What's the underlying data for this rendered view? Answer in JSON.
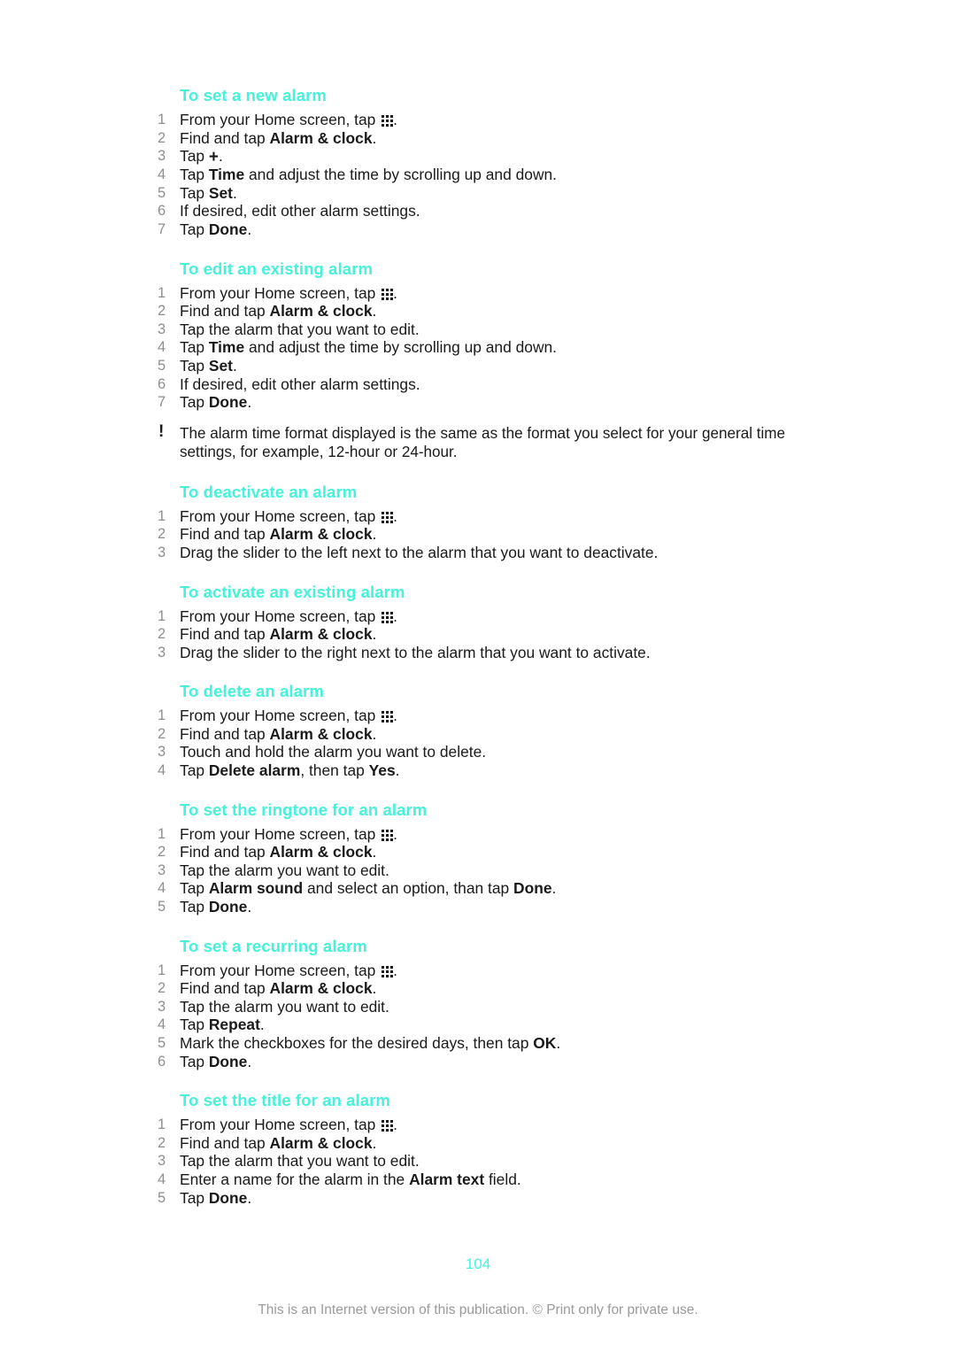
{
  "document": {
    "page_number": "104",
    "footer_note": "This is an Internet version of this publication. © Print only for private use.",
    "heading_color": "#45f2da",
    "number_color": "#8e8e8e",
    "body_color": "#1a1a1a",
    "footer_color": "#9a9a9a"
  },
  "icons": {
    "app_drawer": "app-drawer-icon",
    "plus": "+",
    "note_marker": "!"
  },
  "sections": [
    {
      "heading": "To set a new alarm",
      "steps": [
        {
          "num": "1",
          "parts": [
            {
              "t": "From your Home screen, tap "
            },
            {
              "icon": "app-drawer"
            },
            {
              "t": "."
            }
          ]
        },
        {
          "num": "2",
          "parts": [
            {
              "t": "Find and tap "
            },
            {
              "t": "Alarm & clock",
              "b": true
            },
            {
              "t": "."
            }
          ]
        },
        {
          "num": "3",
          "parts": [
            {
              "t": "Tap "
            },
            {
              "icon": "plus"
            },
            {
              "t": "."
            }
          ]
        },
        {
          "num": "4",
          "parts": [
            {
              "t": "Tap "
            },
            {
              "t": "Time",
              "b": true
            },
            {
              "t": " and adjust the time by scrolling up and down."
            }
          ]
        },
        {
          "num": "5",
          "parts": [
            {
              "t": "Tap "
            },
            {
              "t": "Set",
              "b": true
            },
            {
              "t": "."
            }
          ]
        },
        {
          "num": "6",
          "parts": [
            {
              "t": "If desired, edit other alarm settings."
            }
          ]
        },
        {
          "num": "7",
          "parts": [
            {
              "t": "Tap "
            },
            {
              "t": "Done",
              "b": true
            },
            {
              "t": "."
            }
          ]
        }
      ]
    },
    {
      "heading": "To edit an existing alarm",
      "steps": [
        {
          "num": "1",
          "parts": [
            {
              "t": "From your Home screen, tap "
            },
            {
              "icon": "app-drawer"
            },
            {
              "t": "."
            }
          ]
        },
        {
          "num": "2",
          "parts": [
            {
              "t": "Find and tap "
            },
            {
              "t": "Alarm & clock",
              "b": true
            },
            {
              "t": "."
            }
          ]
        },
        {
          "num": "3",
          "parts": [
            {
              "t": "Tap the alarm that you want to edit."
            }
          ]
        },
        {
          "num": "4",
          "parts": [
            {
              "t": "Tap "
            },
            {
              "t": "Time",
              "b": true
            },
            {
              "t": " and adjust the time by scrolling up and down."
            }
          ]
        },
        {
          "num": "5",
          "parts": [
            {
              "t": "Tap "
            },
            {
              "t": "Set",
              "b": true
            },
            {
              "t": "."
            }
          ]
        },
        {
          "num": "6",
          "parts": [
            {
              "t": "If desired, edit other alarm settings."
            }
          ]
        },
        {
          "num": "7",
          "parts": [
            {
              "t": "Tap "
            },
            {
              "t": "Done",
              "b": true
            },
            {
              "t": "."
            }
          ]
        }
      ],
      "note": "The alarm time format displayed is the same as the format you select for your general time settings, for example, 12-hour or 24-hour."
    },
    {
      "heading": "To deactivate an alarm",
      "steps": [
        {
          "num": "1",
          "parts": [
            {
              "t": "From your Home screen, tap "
            },
            {
              "icon": "app-drawer"
            },
            {
              "t": "."
            }
          ]
        },
        {
          "num": "2",
          "parts": [
            {
              "t": "Find and tap "
            },
            {
              "t": "Alarm & clock",
              "b": true
            },
            {
              "t": "."
            }
          ]
        },
        {
          "num": "3",
          "parts": [
            {
              "t": "Drag the slider to the left next to the alarm that you want to deactivate."
            }
          ]
        }
      ]
    },
    {
      "heading": "To activate an existing alarm",
      "steps": [
        {
          "num": "1",
          "parts": [
            {
              "t": "From your Home screen, tap "
            },
            {
              "icon": "app-drawer"
            },
            {
              "t": "."
            }
          ]
        },
        {
          "num": "2",
          "parts": [
            {
              "t": "Find and tap "
            },
            {
              "t": "Alarm & clock",
              "b": true
            },
            {
              "t": "."
            }
          ]
        },
        {
          "num": "3",
          "parts": [
            {
              "t": "Drag the slider to the right next to the alarm that you want to activate."
            }
          ]
        }
      ]
    },
    {
      "heading": "To delete an alarm",
      "steps": [
        {
          "num": "1",
          "parts": [
            {
              "t": "From your Home screen, tap "
            },
            {
              "icon": "app-drawer"
            },
            {
              "t": "."
            }
          ]
        },
        {
          "num": "2",
          "parts": [
            {
              "t": "Find and tap "
            },
            {
              "t": "Alarm & clock",
              "b": true
            },
            {
              "t": "."
            }
          ]
        },
        {
          "num": "3",
          "parts": [
            {
              "t": "Touch and hold the alarm you want to delete."
            }
          ]
        },
        {
          "num": "4",
          "parts": [
            {
              "t": "Tap "
            },
            {
              "t": "Delete alarm",
              "b": true
            },
            {
              "t": ", then tap "
            },
            {
              "t": "Yes",
              "b": true
            },
            {
              "t": "."
            }
          ]
        }
      ]
    },
    {
      "heading": "To set the ringtone for an alarm",
      "steps": [
        {
          "num": "1",
          "parts": [
            {
              "t": "From your Home screen, tap "
            },
            {
              "icon": "app-drawer"
            },
            {
              "t": "."
            }
          ]
        },
        {
          "num": "2",
          "parts": [
            {
              "t": "Find and tap "
            },
            {
              "t": "Alarm & clock",
              "b": true
            },
            {
              "t": "."
            }
          ]
        },
        {
          "num": "3",
          "parts": [
            {
              "t": "Tap the alarm you want to edit."
            }
          ]
        },
        {
          "num": "4",
          "parts": [
            {
              "t": "Tap "
            },
            {
              "t": "Alarm sound",
              "b": true
            },
            {
              "t": " and select an option, than tap "
            },
            {
              "t": "Done",
              "b": true
            },
            {
              "t": "."
            }
          ]
        },
        {
          "num": "5",
          "parts": [
            {
              "t": "Tap "
            },
            {
              "t": "Done",
              "b": true
            },
            {
              "t": "."
            }
          ]
        }
      ]
    },
    {
      "heading": "To set a recurring alarm",
      "steps": [
        {
          "num": "1",
          "parts": [
            {
              "t": "From your Home screen, tap "
            },
            {
              "icon": "app-drawer"
            },
            {
              "t": "."
            }
          ]
        },
        {
          "num": "2",
          "parts": [
            {
              "t": "Find and tap "
            },
            {
              "t": "Alarm & clock",
              "b": true
            },
            {
              "t": "."
            }
          ]
        },
        {
          "num": "3",
          "parts": [
            {
              "t": "Tap the alarm you want to edit."
            }
          ]
        },
        {
          "num": "4",
          "parts": [
            {
              "t": "Tap "
            },
            {
              "t": "Repeat",
              "b": true
            },
            {
              "t": "."
            }
          ]
        },
        {
          "num": "5",
          "parts": [
            {
              "t": "Mark the checkboxes for the desired days, then tap "
            },
            {
              "t": "OK",
              "b": true
            },
            {
              "t": "."
            }
          ]
        },
        {
          "num": "6",
          "parts": [
            {
              "t": "Tap "
            },
            {
              "t": "Done",
              "b": true
            },
            {
              "t": "."
            }
          ]
        }
      ]
    },
    {
      "heading": "To set the title for an alarm",
      "steps": [
        {
          "num": "1",
          "parts": [
            {
              "t": "From your Home screen, tap "
            },
            {
              "icon": "app-drawer"
            },
            {
              "t": "."
            }
          ]
        },
        {
          "num": "2",
          "parts": [
            {
              "t": "Find and tap "
            },
            {
              "t": "Alarm & clock",
              "b": true
            },
            {
              "t": "."
            }
          ]
        },
        {
          "num": "3",
          "parts": [
            {
              "t": "Tap the alarm that you want to edit."
            }
          ]
        },
        {
          "num": "4",
          "parts": [
            {
              "t": "Enter a name for the alarm in the "
            },
            {
              "t": "Alarm text",
              "b": true
            },
            {
              "t": " field."
            }
          ]
        },
        {
          "num": "5",
          "parts": [
            {
              "t": "Tap "
            },
            {
              "t": "Done",
              "b": true
            },
            {
              "t": "."
            }
          ]
        }
      ]
    }
  ]
}
